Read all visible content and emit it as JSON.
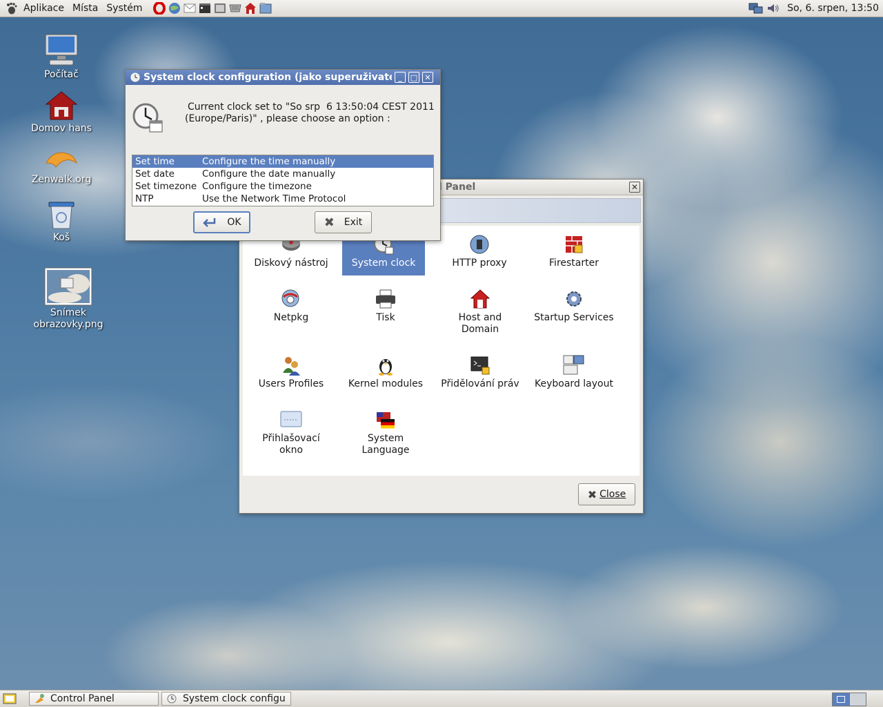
{
  "top_panel": {
    "menus": [
      "Aplikace",
      "Místa",
      "Systém"
    ],
    "clock": "So,  6. srpen, 13:50"
  },
  "desktop": {
    "icons": [
      {
        "label": "Počítač"
      },
      {
        "label": "Domov hans"
      },
      {
        "label": "Zenwalk.org"
      },
      {
        "label": "Koš"
      },
      {
        "label": "Snímek obrazovky.png"
      }
    ]
  },
  "control_panel": {
    "title_fragment": "l Panel",
    "items": [
      {
        "label": "Diskový nástroj"
      },
      {
        "label": "System clock"
      },
      {
        "label": "HTTP proxy"
      },
      {
        "label": "Firestarter"
      },
      {
        "label": "Netpkg"
      },
      {
        "label": "Tisk"
      },
      {
        "label": "Host and Domain"
      },
      {
        "label": "Startup Services"
      },
      {
        "label": "Users Profiles"
      },
      {
        "label": "Kernel modules"
      },
      {
        "label": "Přidělování práv"
      },
      {
        "label": "Keyboard layout"
      },
      {
        "label": "Přihlašovací okno"
      },
      {
        "label": "System Language"
      }
    ],
    "close_label": "Close"
  },
  "clock_dialog": {
    "title": "System clock configuration (jako superuživatel",
    "message_line1": "Current clock set to \"So srp  6 13:50:04 CEST 2011",
    "message_line2": "(Europe/Paris)\" , please choose an option :",
    "options": [
      {
        "name": "Set time",
        "desc": "Configure the time manually"
      },
      {
        "name": "Set date",
        "desc": "Configure the date manually"
      },
      {
        "name": "Set timezone",
        "desc": "Configure the timezone"
      },
      {
        "name": "NTP",
        "desc": "Use the Network Time Protocol"
      }
    ],
    "ok_label": "OK",
    "exit_label": "Exit"
  },
  "taskbar": {
    "tasks": [
      {
        "label": "Control Panel"
      },
      {
        "label": "System clock configu..."
      }
    ]
  },
  "colors": {
    "selection": "#5a7fbf",
    "titlebar_active": "#5879b8"
  }
}
